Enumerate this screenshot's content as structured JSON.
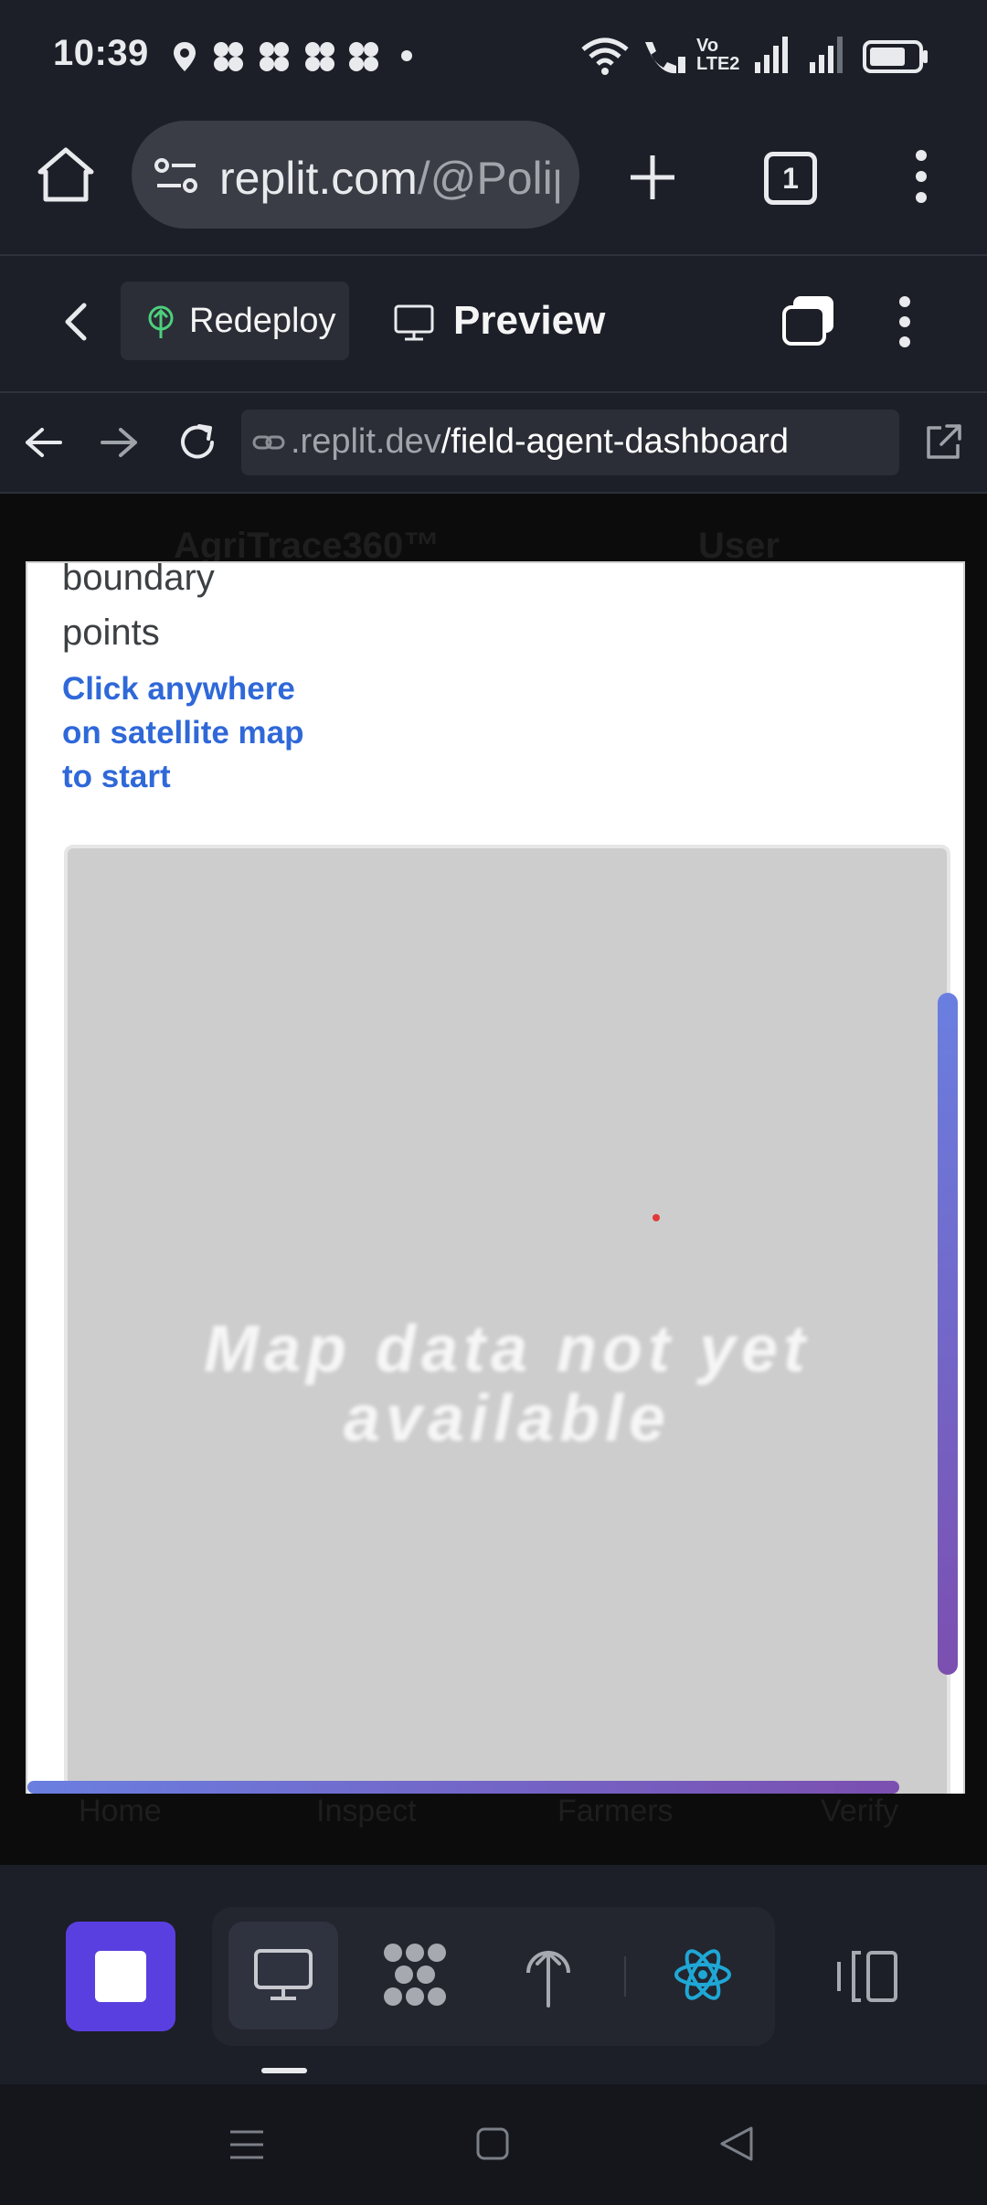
{
  "status_bar": {
    "time": "10:39",
    "icons": [
      "location-icon",
      "pinwheel-icon",
      "pinwheel-icon",
      "pinwheel-icon",
      "pinwheel-icon",
      "dot-icon",
      "wifi-icon",
      "wifi-call-icon",
      "volte-icon",
      "signal-icon",
      "signal-icon",
      "battery-icon"
    ],
    "volte_label": "Vo LTE2"
  },
  "browser": {
    "url_visible": "replit.com",
    "url_dim": "/@Polip",
    "tab_count": "1"
  },
  "replit_header": {
    "redeploy_label": "Redeploy",
    "preview_label": "Preview"
  },
  "webview_nav": {
    "address_dim": ".replit.dev",
    "address_path": "/field-agent-dashboard"
  },
  "page": {
    "boundary_text": "boundary points",
    "click_instruction": "Click anywhere on satellite map to start",
    "map_placeholder": "Map data not yet available"
  },
  "background_page": {
    "app_name": "AgriTrace360™",
    "user_label": "User",
    "nav_items": [
      "Home",
      "Inspect",
      "Farmers",
      "Verify"
    ]
  },
  "bottom_toolbar": {
    "icons": [
      "stop-icon",
      "monitor-icon",
      "workflow-icon",
      "deploy-icon",
      "react-icon",
      "panels-icon"
    ]
  },
  "colors": {
    "accent_purple": "#5a3fe0",
    "link_blue": "#2f68d8",
    "react_blue": "#1fa7d6",
    "redeploy_green": "#4cd07d"
  }
}
